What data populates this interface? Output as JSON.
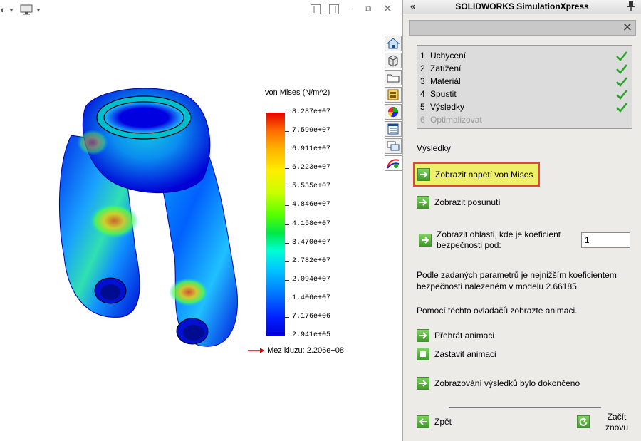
{
  "panel": {
    "title": "SOLIDWORKS SimulationXpress",
    "collapse_icon": "«",
    "close_icon": "✕",
    "steps": [
      {
        "num": "1",
        "label": "Uchycení",
        "done": true
      },
      {
        "num": "2",
        "label": "Zatížení",
        "done": true
      },
      {
        "num": "3",
        "label": "Materiál",
        "done": true
      },
      {
        "num": "4",
        "label": "Spustit",
        "done": true
      },
      {
        "num": "5",
        "label": "Výsledky",
        "done": true
      },
      {
        "num": "6",
        "label": "Optimalizovat",
        "done": false
      }
    ],
    "section_title": "Výsledky",
    "btn_von_mises": "Zobrazit napětí von Mises",
    "btn_displacement": "Zobrazit posunutí",
    "btn_fos_line1": "Zobrazit oblasti, kde je koeficient",
    "btn_fos_line2": "bezpečnosti pod:",
    "fos_value": "1",
    "result_text_line1": "Podle zadaných parametrů je nejnižším koeficientem",
    "result_text_line2": "bezpečnosti nalezeném v modelu 2.66185",
    "animation_text": "Pomocí těchto ovladačů zobrazte animaci.",
    "btn_play": "Přehrát animaci",
    "btn_stop": "Zastavit animaci",
    "btn_done": "Zobrazování výsledků bylo dokončeno",
    "btn_back": "Zpět",
    "btn_restart_line1": "Začít",
    "btn_restart_line2": "znovu"
  },
  "legend": {
    "title": "von Mises (N/m^2)",
    "ticks": [
      "8.287e+07",
      "7.599e+07",
      "6.911e+07",
      "6.223e+07",
      "5.535e+07",
      "4.846e+07",
      "4.158e+07",
      "3.470e+07",
      "2.782e+07",
      "2.094e+07",
      "1.406e+07",
      "7.176e+06",
      "2.941e+05"
    ],
    "yield": "Mez kluzu: 2.206e+08"
  },
  "tabs": [
    "home-icon",
    "part-icon",
    "folder-icon",
    "properties-icon",
    "appearance-icon",
    "custom-properties-icon",
    "forum-icon",
    "simulationxpress-icon"
  ],
  "colors": {
    "accent_green": "#3f9a2a",
    "highlight": "#eef06a",
    "highlight_border": "#e6443a",
    "check_green": "#2aa52a"
  }
}
